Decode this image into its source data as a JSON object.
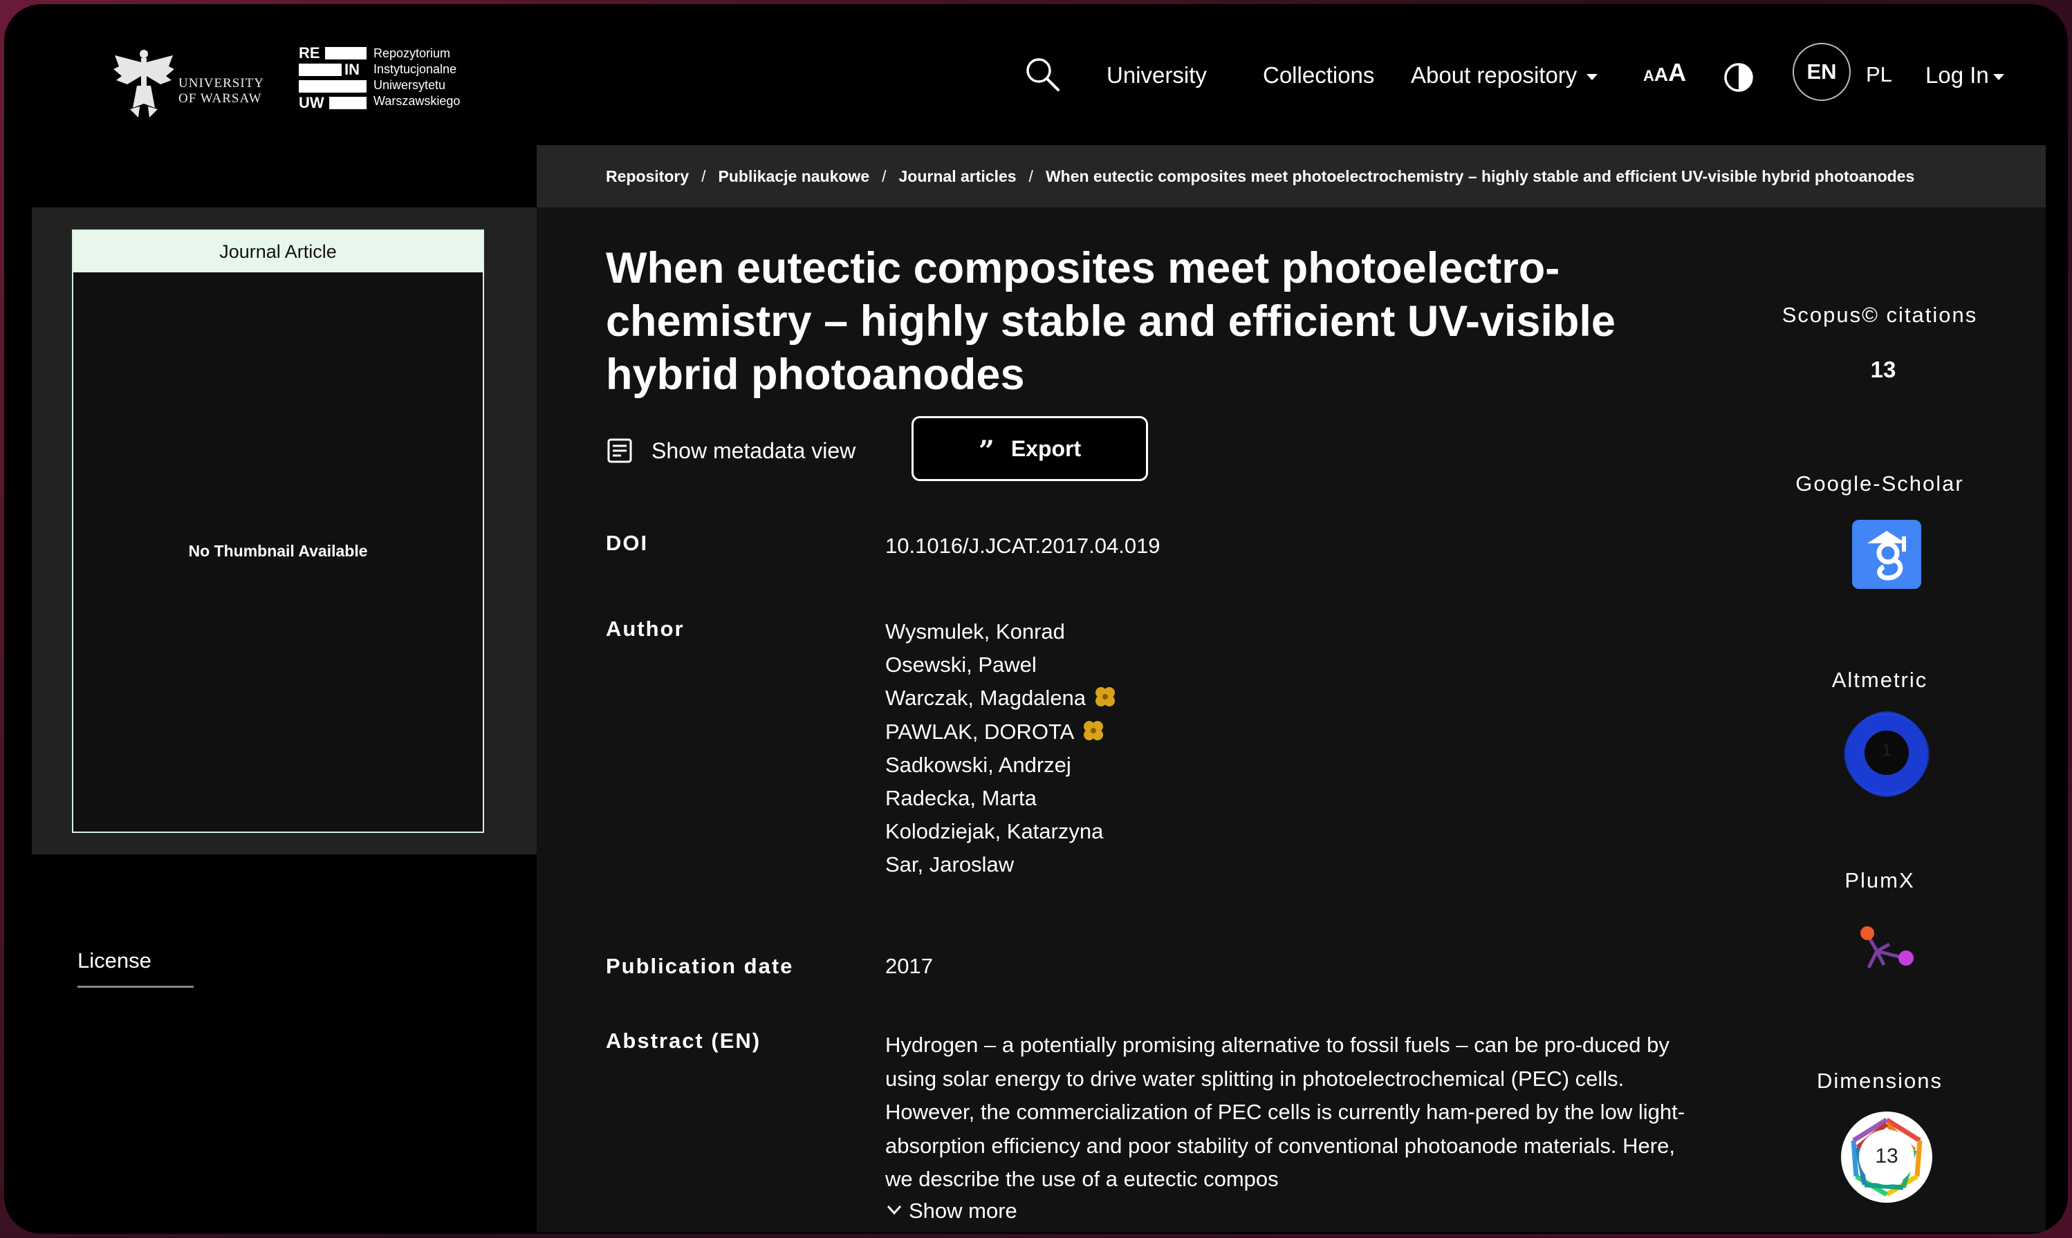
{
  "brand": {
    "uw_text_line1": "UNIVERSITY",
    "uw_text_line2": "OF WARSAW",
    "rein_marks": [
      "RE",
      "IN",
      "UW"
    ],
    "rein_line1": "Repozytorium",
    "rein_line2": "Instytucjonalne",
    "rein_line3": "Uniwersytetu",
    "rein_line4": "Warszawskiego"
  },
  "nav": {
    "search_icon": "search-icon",
    "university": "University",
    "collections": "Collections",
    "about": "About repository",
    "font_size_a1": "A",
    "font_size_a2": "A",
    "font_size_a3": "A",
    "contrast_icon": "contrast-icon",
    "lang_en": "EN",
    "lang_pl": "PL",
    "login": "Log In"
  },
  "breadcrumb": {
    "items": [
      "Repository",
      "Publikacje naukowe",
      "Journal articles"
    ],
    "separator": "/",
    "current": "When eutectic composites meet photoelectrochemistry – highly stable and efficient UV-visible hybrid photoanodes"
  },
  "sidebar": {
    "item_type": "Journal Article",
    "no_thumbnail": "No Thumbnail Available",
    "license": "License"
  },
  "item": {
    "title": "When eutectic composites meet photoelectro-chemistry – highly stable and efficient UV-visible hybrid photoanodes",
    "metadata_view": "Show metadata view",
    "export": "Export",
    "export_icon": "quote-icon",
    "doi_label": "DOI",
    "doi": "10.1016/J.JCAT.2017.04.019",
    "author_label": "Author",
    "authors": [
      {
        "name": "Wysmulek, Konrad",
        "orcid": false
      },
      {
        "name": "Osewski, Pawel",
        "orcid": false
      },
      {
        "name": "Warczak, Magdalena",
        "orcid": true
      },
      {
        "name": "PAWLAK, DOROTA",
        "orcid": true
      },
      {
        "name": "Sadkowski, Andrzej",
        "orcid": false
      },
      {
        "name": "Radecka, Marta",
        "orcid": false
      },
      {
        "name": "Kolodziejak, Katarzyna",
        "orcid": false
      },
      {
        "name": "Sar, Jaroslaw",
        "orcid": false
      }
    ],
    "date_label": "Publication date",
    "date": "2017",
    "abstract_label": "Abstract (EN)",
    "abstract": "Hydrogen – a potentially promising alternative to fossil fuels – can be pro-duced by using solar energy to drive water splitting in photoelectrochemical (PEC) cells. However, the commercialization of PEC cells is currently ham-pered by the low light-absorption efficiency and poor stability of conventional photoanode materials. Here, we describe the use of a eutectic compos",
    "show_more": "Show more"
  },
  "metrics": {
    "scopus_label": "Scopus© citations",
    "scopus_value": "13",
    "gs_label": "Google-Scholar",
    "altmetric_label": "Altmetric",
    "altmetric_score": "1",
    "plumx_label": "PlumX",
    "dimensions_label": "Dimensions",
    "dimensions_value": "13"
  },
  "colors": {
    "background": "#121212",
    "header": "#000000",
    "breadcrumb_bg": "#262626",
    "badge_bg": "#e8f7ec",
    "gs_blue": "#4285f4",
    "altmetric_blue": "#1a3fd6"
  }
}
